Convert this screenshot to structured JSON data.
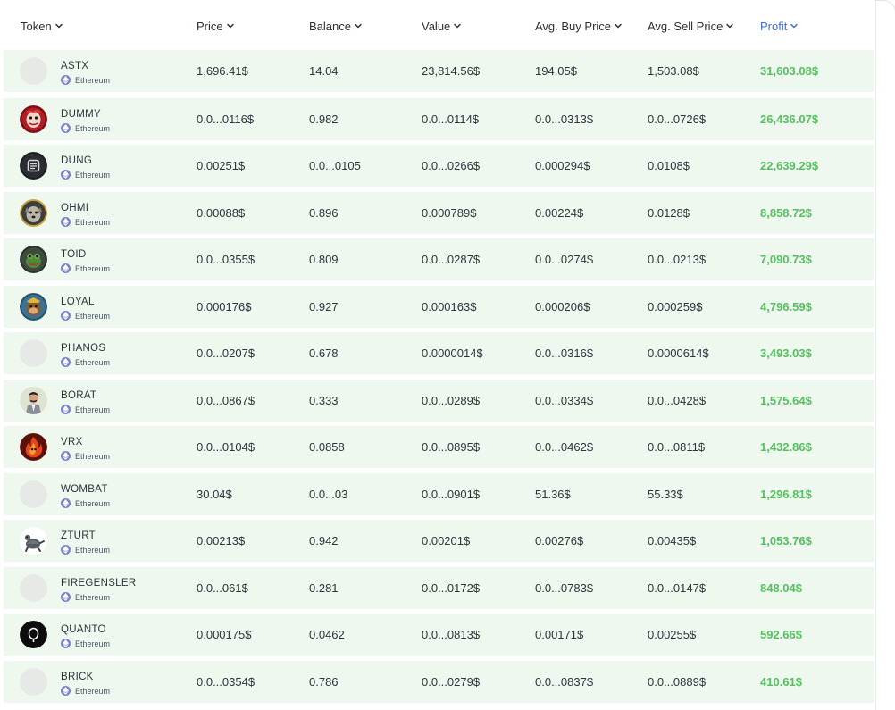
{
  "header": {
    "columns": [
      {
        "label": "Token",
        "active": false
      },
      {
        "label": "Price",
        "active": false
      },
      {
        "label": "Balance",
        "active": false
      },
      {
        "label": "Value",
        "active": false
      },
      {
        "label": "Avg. Buy Price",
        "active": false
      },
      {
        "label": "Avg. Sell Price",
        "active": false
      },
      {
        "label": "Profit",
        "active": true
      }
    ]
  },
  "colors": {
    "row_bg": "#eff8ef",
    "profit": "#55c05f",
    "active_header": "#3a6fd8"
  },
  "rows": [
    {
      "token": "ASTX",
      "chain": "Ethereum",
      "avatar": "blank",
      "price": "1,696.41$",
      "balance": "14.04",
      "value": "23,814.56$",
      "avg_buy": "194.05$",
      "avg_sell": "1,503.08$",
      "profit": "31,603.08$"
    },
    {
      "token": "DUMMY",
      "chain": "Ethereum",
      "avatar": "red-creature",
      "price": "0.0...0116$",
      "balance": "0.982",
      "value": "0.0...0114$",
      "avg_buy": "0.0...0313$",
      "avg_sell": "0.0...0726$",
      "profit": "26,436.07$"
    },
    {
      "token": "DUNG",
      "chain": "Ethereum",
      "avatar": "dark-logo",
      "price": "0.00251$",
      "balance": "0.0...0105",
      "value": "0.0...0266$",
      "avg_buy": "0.000294$",
      "avg_sell": "0.0108$",
      "profit": "22,639.29$"
    },
    {
      "token": "OHMI",
      "chain": "Ethereum",
      "avatar": "dog",
      "price": "0.00088$",
      "balance": "0.896",
      "value": "0.000789$",
      "avg_buy": "0.00224$",
      "avg_sell": "0.0128$",
      "profit": "8,858.72$"
    },
    {
      "token": "TOID",
      "chain": "Ethereum",
      "avatar": "frog",
      "price": "0.0...0355$",
      "balance": "0.809",
      "value": "0.0...0287$",
      "avg_buy": "0.0...0274$",
      "avg_sell": "0.0...0213$",
      "profit": "7,090.73$"
    },
    {
      "token": "LOYAL",
      "chain": "Ethereum",
      "avatar": "ape",
      "price": "0.000176$",
      "balance": "0.927",
      "value": "0.000163$",
      "avg_buy": "0.000206$",
      "avg_sell": "0.000259$",
      "profit": "4,796.59$"
    },
    {
      "token": "PHANOS",
      "chain": "Ethereum",
      "avatar": "blank",
      "price": "0.0...0207$",
      "balance": "0.678",
      "value": "0.0000014$",
      "avg_buy": "0.0...0316$",
      "avg_sell": "0.0000614$",
      "profit": "3,493.03$"
    },
    {
      "token": "BORAT",
      "chain": "Ethereum",
      "avatar": "person",
      "price": "0.0...0867$",
      "balance": "0.333",
      "value": "0.0...0289$",
      "avg_buy": "0.0...0334$",
      "avg_sell": "0.0...0428$",
      "profit": "1,575.64$"
    },
    {
      "token": "VRX",
      "chain": "Ethereum",
      "avatar": "fire",
      "price": "0.0...0104$",
      "balance": "0.0858",
      "value": "0.0...0895$",
      "avg_buy": "0.0...0462$",
      "avg_sell": "0.0...0811$",
      "profit": "1,432.86$"
    },
    {
      "token": "WOMBAT",
      "chain": "Ethereum",
      "avatar": "blank",
      "price": "30.04$",
      "balance": "0.0...03",
      "value": "0.0...0901$",
      "avg_buy": "51.36$",
      "avg_sell": "55.33$",
      "profit": "1,296.81$"
    },
    {
      "token": "ZTURT",
      "chain": "Ethereum",
      "avatar": "turtle",
      "price": "0.00213$",
      "balance": "0.942",
      "value": "0.00201$",
      "avg_buy": "0.00276$",
      "avg_sell": "0.00435$",
      "profit": "1,053.76$"
    },
    {
      "token": "FIREGENSLER",
      "chain": "Ethereum",
      "avatar": "blank",
      "price": "0.0...061$",
      "balance": "0.281",
      "value": "0.0...0172$",
      "avg_buy": "0.0...0783$",
      "avg_sell": "0.0...0147$",
      "profit": "848.04$"
    },
    {
      "token": "QUANTO",
      "chain": "Ethereum",
      "avatar": "q-logo",
      "price": "0.000175$",
      "balance": "0.0462",
      "value": "0.0...0813$",
      "avg_buy": "0.00171$",
      "avg_sell": "0.00255$",
      "profit": "592.66$"
    },
    {
      "token": "BRICK",
      "chain": "Ethereum",
      "avatar": "blank",
      "price": "0.0...0354$",
      "balance": "0.786",
      "value": "0.0...0279$",
      "avg_buy": "0.0...0837$",
      "avg_sell": "0.0...0889$",
      "profit": "410.61$"
    }
  ]
}
